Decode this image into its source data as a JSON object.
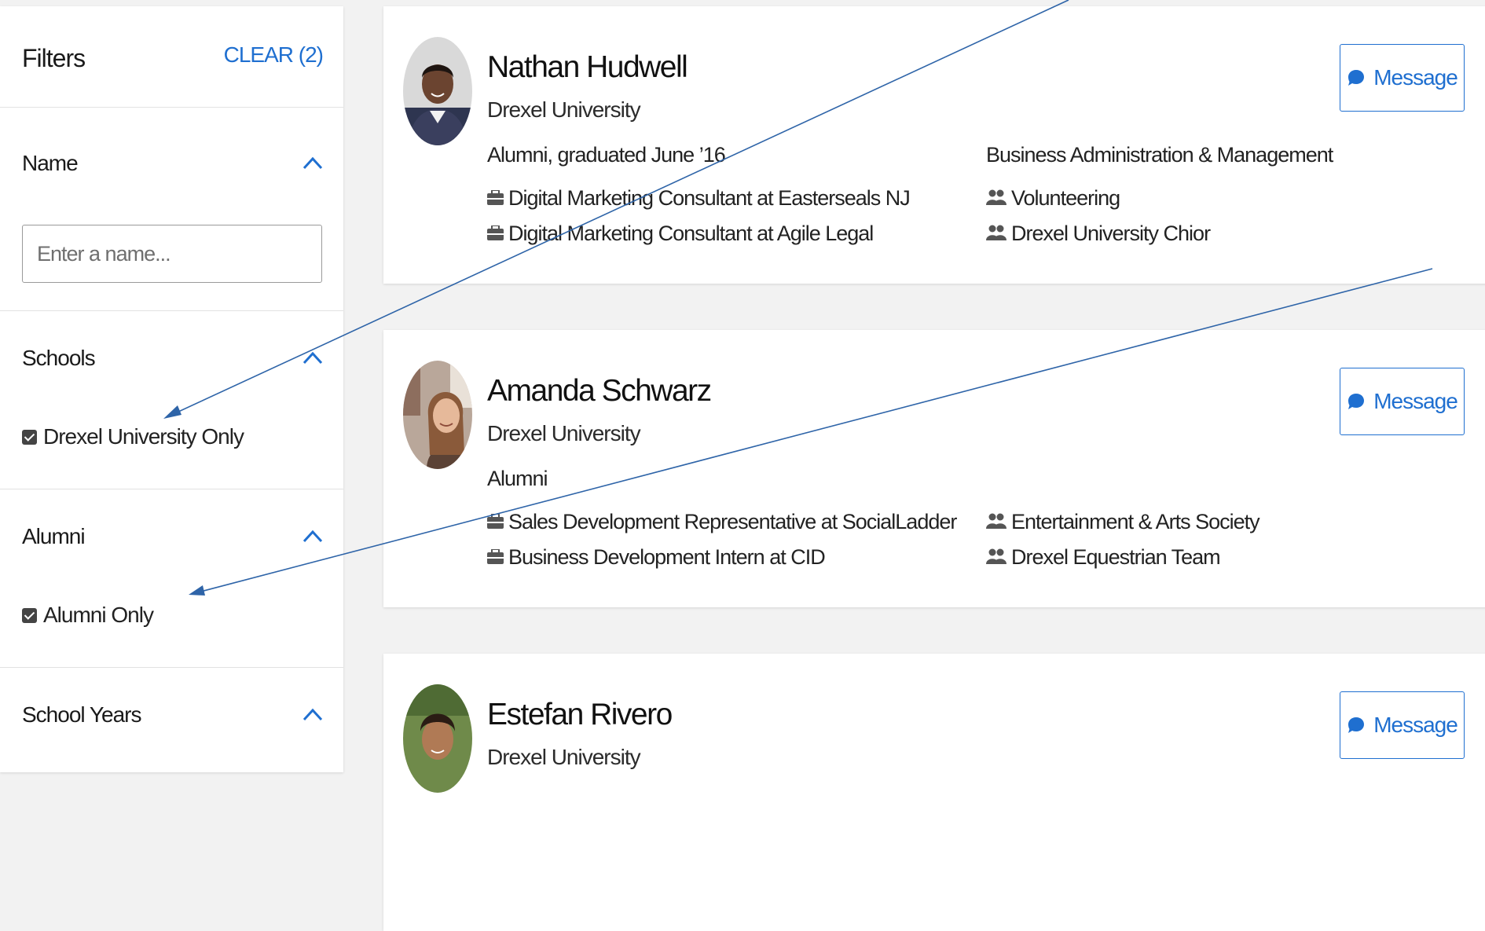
{
  "filters": {
    "title": "Filters",
    "clear_label": "CLEAR (2)",
    "sections": {
      "name": {
        "title": "Name",
        "placeholder": "Enter a name..."
      },
      "schools": {
        "title": "Schools",
        "option_label": "Drexel University Only",
        "checked": true
      },
      "alumni": {
        "title": "Alumni",
        "option_label": "Alumni Only",
        "checked": true
      },
      "school_years": {
        "title": "School Years"
      }
    }
  },
  "people": [
    {
      "name": "Nathan Hudwell",
      "school": "Drexel University",
      "status": "Alumni, graduated June ’16",
      "major": "Business Administration & Management",
      "jobs": [
        "Digital Marketing Consultant at Easterseals NJ",
        "Digital Marketing Consultant at Agile Legal"
      ],
      "groups": [
        "Volunteering",
        "Drexel University Chior"
      ],
      "message_label": "Message"
    },
    {
      "name": "Amanda Schwarz",
      "school": "Drexel University",
      "status": "Alumni",
      "major": "",
      "jobs": [
        "Sales Development Representative at SocialLadder",
        "Business Development Intern at CID"
      ],
      "groups": [
        "Entertainment & Arts Society",
        "Drexel Equestrian Team"
      ],
      "message_label": "Message"
    },
    {
      "name": "Estefan Rivero",
      "school": "Drexel University",
      "message_label": "Message"
    }
  ],
  "colors": {
    "accent": "#1f6fd0",
    "annotation_arrow": "#2e64a8",
    "page_background": "#f2f2f2"
  },
  "icons": {
    "collapse": "chevron-up-icon",
    "job": "briefcase-icon",
    "group": "people-group-icon",
    "message": "chat-bubble-icon"
  }
}
